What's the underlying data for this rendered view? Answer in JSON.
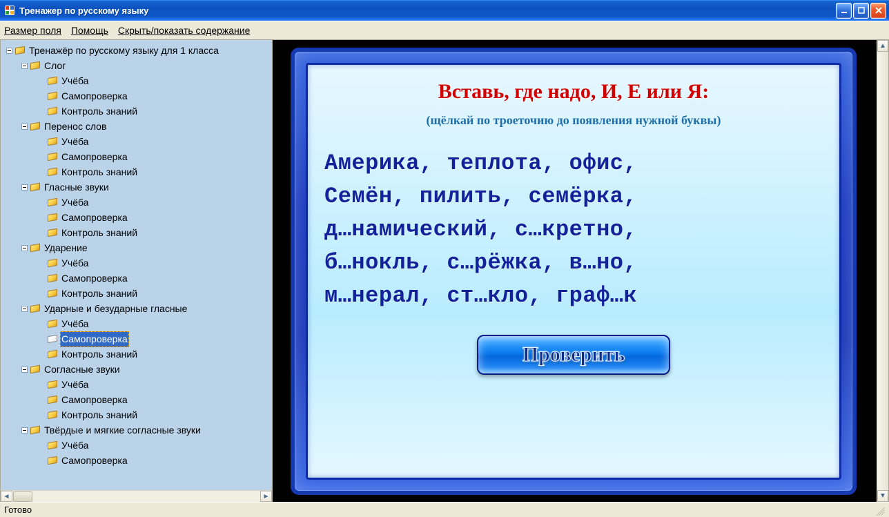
{
  "window": {
    "title": "Тренажер по русскому языку"
  },
  "menu": {
    "size": "Размер поля",
    "help": "Помощь",
    "toggle": "Скрыть/показать содержание"
  },
  "tree": {
    "root": "Тренажёр по русскому языку для 1 класса",
    "units": [
      "Слог",
      "Перенос слов",
      "Гласные звуки",
      "Ударение",
      "Ударные и безударные гласные",
      "Согласные звуки",
      "Твёрдые и мягкие согласные звуки"
    ],
    "leaf_0": "Учёба",
    "leaf_1": "Самопроверка",
    "leaf_2": "Контроль знаний"
  },
  "exercise": {
    "heading": "Вставь, где надо, И, Е или Я:",
    "subheading": "(щёлкай по троеточию до появления нужной буквы)",
    "line1": "Америка, теплота, офис,",
    "line2": "Семён, пилить, семёрка,",
    "line3": "д…намический, с…кретно,",
    "line4": "б…нокль, с…рёжка, в…но,",
    "line5": "м…нерал, ст…кло, граф…к",
    "check": "Проверить"
  },
  "status": "Готово"
}
